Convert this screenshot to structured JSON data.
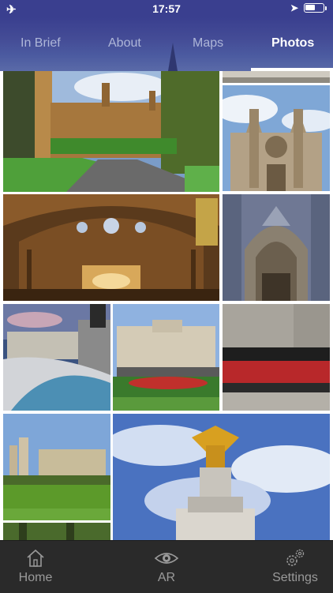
{
  "status_bar": {
    "time": "17:57",
    "battery_level": 0.55
  },
  "top_tabs": [
    {
      "label": "In Brief",
      "active": false
    },
    {
      "label": "About",
      "active": false
    },
    {
      "label": "Maps",
      "active": false
    },
    {
      "label": "Photos",
      "active": true
    }
  ],
  "bottom_tabs": [
    {
      "label": "Home",
      "icon": "home-icon"
    },
    {
      "label": "AR",
      "icon": "eye-icon"
    },
    {
      "label": "Settings",
      "icon": "gears-icon"
    }
  ],
  "colors": {
    "nav": "#3a3f8f",
    "tabbar": "#2a2a2a",
    "active_tab": "#ffffff",
    "inactive_tab": "#aeb6d8"
  }
}
